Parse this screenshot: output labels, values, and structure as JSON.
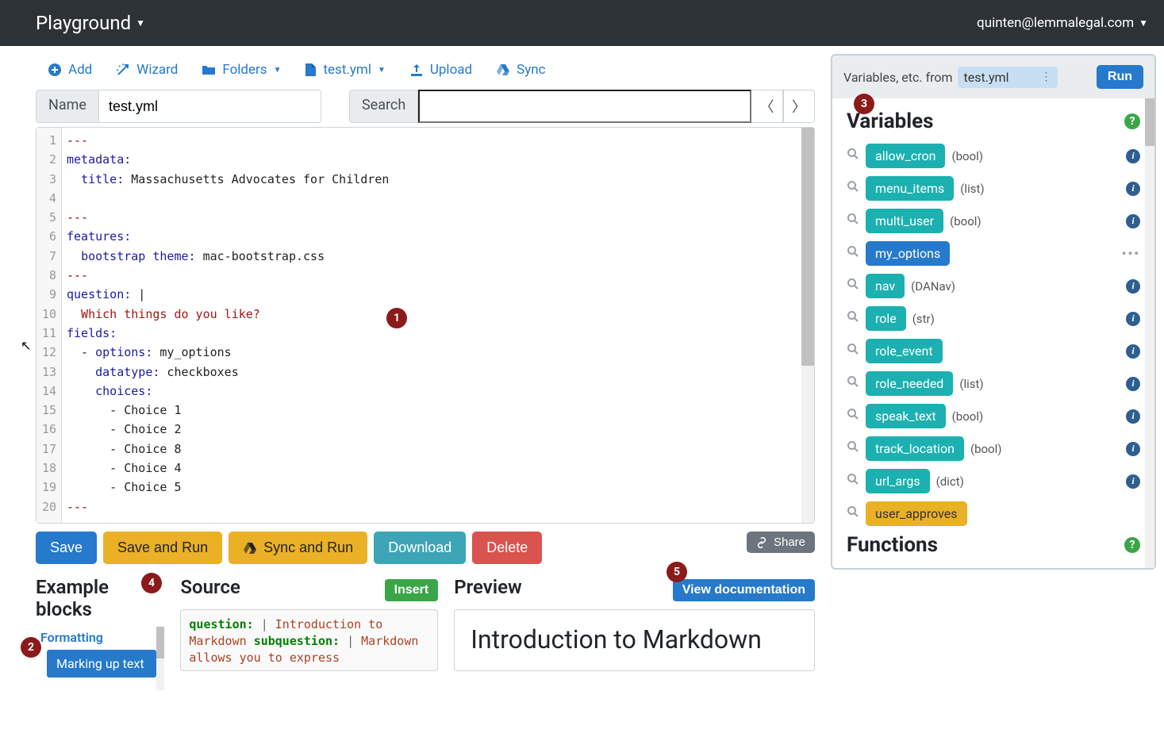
{
  "navbar": {
    "brand": "Playground",
    "user": "quinten@lemmalegal.com"
  },
  "toolbar": {
    "add": "Add",
    "wizard": "Wizard",
    "folders": "Folders",
    "current_file": "test.yml",
    "upload": "Upload",
    "sync": "Sync"
  },
  "name_field": {
    "label": "Name",
    "value": "test.yml"
  },
  "search_field": {
    "label": "Search",
    "value": ""
  },
  "editor": {
    "lines": [
      {
        "n": 1,
        "seg": [
          {
            "t": "---",
            "c": "tok-meta"
          }
        ]
      },
      {
        "n": 2,
        "seg": [
          {
            "t": "metadata:",
            "c": "tok-key"
          }
        ]
      },
      {
        "n": 3,
        "seg": [
          {
            "t": "  ",
            "c": ""
          },
          {
            "t": "title:",
            "c": "tok-key"
          },
          {
            "t": " Massachusetts Advocates for Children",
            "c": "tok-str"
          }
        ]
      },
      {
        "n": 4,
        "seg": [
          {
            "t": "",
            "c": ""
          }
        ]
      },
      {
        "n": 5,
        "seg": [
          {
            "t": "---",
            "c": "tok-meta"
          }
        ]
      },
      {
        "n": 6,
        "seg": [
          {
            "t": "features:",
            "c": "tok-key"
          }
        ]
      },
      {
        "n": 7,
        "seg": [
          {
            "t": "  ",
            "c": ""
          },
          {
            "t": "bootstrap theme:",
            "c": "tok-key"
          },
          {
            "t": " mac-bootstrap.css",
            "c": "tok-str"
          }
        ]
      },
      {
        "n": 8,
        "seg": [
          {
            "t": "---",
            "c": "tok-meta"
          }
        ]
      },
      {
        "n": 9,
        "seg": [
          {
            "t": "question:",
            "c": "tok-key"
          },
          {
            "t": " |",
            "c": "tok-str"
          }
        ]
      },
      {
        "n": 10,
        "seg": [
          {
            "t": "  Which things do you like?",
            "c": "tok-plain"
          }
        ]
      },
      {
        "n": 11,
        "seg": [
          {
            "t": "fields:",
            "c": "tok-key"
          }
        ]
      },
      {
        "n": 12,
        "seg": [
          {
            "t": "  - ",
            "c": "tok-str"
          },
          {
            "t": "options:",
            "c": "tok-key"
          },
          {
            "t": " my_options",
            "c": "tok-str"
          }
        ]
      },
      {
        "n": 13,
        "seg": [
          {
            "t": "    ",
            "c": ""
          },
          {
            "t": "datatype:",
            "c": "tok-key"
          },
          {
            "t": " checkboxes",
            "c": "tok-str"
          }
        ]
      },
      {
        "n": 14,
        "seg": [
          {
            "t": "    ",
            "c": ""
          },
          {
            "t": "choices:",
            "c": "tok-key"
          }
        ]
      },
      {
        "n": 15,
        "seg": [
          {
            "t": "      - Choice 1",
            "c": "tok-str"
          }
        ]
      },
      {
        "n": 16,
        "seg": [
          {
            "t": "      - Choice 2",
            "c": "tok-str"
          }
        ]
      },
      {
        "n": 17,
        "seg": [
          {
            "t": "      - Choice 8",
            "c": "tok-str"
          }
        ]
      },
      {
        "n": 18,
        "seg": [
          {
            "t": "      - Choice 4",
            "c": "tok-str"
          }
        ]
      },
      {
        "n": 19,
        "seg": [
          {
            "t": "      - Choice 5",
            "c": "tok-str"
          }
        ]
      },
      {
        "n": 20,
        "seg": [
          {
            "t": "---",
            "c": "tok-meta"
          }
        ]
      }
    ]
  },
  "actions": {
    "save": "Save",
    "save_run": "Save and Run",
    "sync_run": "Sync and Run",
    "download": "Download",
    "delete": "Delete",
    "share": "Share"
  },
  "example": {
    "title": "Example blocks",
    "group": "Formatting",
    "item": "Marking up text"
  },
  "source": {
    "title": "Source",
    "insert": "Insert",
    "l1a": "question:",
    "l1b": " |",
    "l2": "  Introduction to Markdown",
    "l3a": "subquestion:",
    "l3b": " |",
    "l4": "  Markdown allows you to express"
  },
  "preview": {
    "title": "Preview",
    "viewdoc": "View documentation",
    "heading": "Introduction to Markdown"
  },
  "right": {
    "from_label": "Variables, etc. from",
    "file": "test.yml",
    "run": "Run",
    "variables_title": "Variables",
    "functions_title": "Functions",
    "vars": [
      {
        "name": "allow_cron",
        "type": "(bool)",
        "kind": "teal",
        "icon": "info"
      },
      {
        "name": "menu_items",
        "type": "(list)",
        "kind": "teal",
        "icon": "info"
      },
      {
        "name": "multi_user",
        "type": "(bool)",
        "kind": "teal",
        "icon": "info"
      },
      {
        "name": "my_options",
        "type": "",
        "kind": "sel",
        "icon": "dots"
      },
      {
        "name": "nav",
        "type": "(DANav)",
        "kind": "teal",
        "icon": "info"
      },
      {
        "name": "role",
        "type": "(str)",
        "kind": "teal",
        "icon": "info"
      },
      {
        "name": "role_event",
        "type": "",
        "kind": "teal",
        "icon": "info"
      },
      {
        "name": "role_needed",
        "type": "(list)",
        "kind": "teal",
        "icon": "info"
      },
      {
        "name": "speak_text",
        "type": "(bool)",
        "kind": "teal",
        "icon": "info"
      },
      {
        "name": "track_location",
        "type": "(bool)",
        "kind": "teal",
        "icon": "info"
      },
      {
        "name": "url_args",
        "type": "(dict)",
        "kind": "teal",
        "icon": "info"
      },
      {
        "name": "user_approves",
        "type": "",
        "kind": "yel",
        "icon": ""
      }
    ]
  },
  "annotations": [
    "1",
    "2",
    "3",
    "4",
    "5"
  ]
}
